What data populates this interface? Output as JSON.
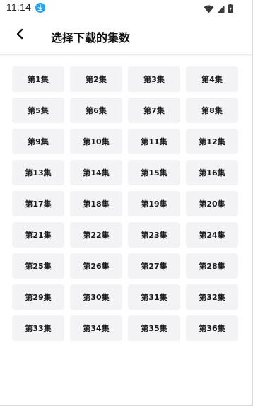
{
  "status_bar": {
    "time": "11:14",
    "icons": [
      "download-icon",
      "wifi-icon",
      "signal-icon",
      "battery-icon"
    ],
    "download_color": "#1aa3ff"
  },
  "header": {
    "back_icon": "chevron-left-icon",
    "title": "选择下载的集数"
  },
  "episodes": [
    "第1集",
    "第2集",
    "第3集",
    "第4集",
    "第5集",
    "第6集",
    "第7集",
    "第8集",
    "第9集",
    "第10集",
    "第11集",
    "第12集",
    "第13集",
    "第14集",
    "第15集",
    "第16集",
    "第17集",
    "第18集",
    "第19集",
    "第20集",
    "第21集",
    "第22集",
    "第23集",
    "第24集",
    "第25集",
    "第26集",
    "第27集",
    "第28集",
    "第29集",
    "第30集",
    "第31集",
    "第32集",
    "第33集",
    "第34集",
    "第35集",
    "第36集"
  ],
  "colors": {
    "episode_bg": "#f3f3f6",
    "text": "#1a1a1a"
  }
}
